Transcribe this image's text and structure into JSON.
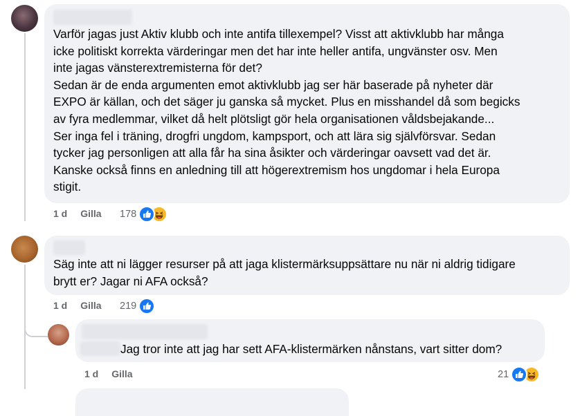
{
  "comments": [
    {
      "text": "Varför jagas just Aktiv klubb och inte antifa tillexempel? Visst att aktivklubb har många\nicke politiskt korrekta värderingar men det har inte heller antifa, ungvänster osv. Men\ninte jagas vänsterextremisterna för det?\nSedan är de enda argumenten emot aktivklubb jag ser här baserade på nyheter där\nEXPO är källan, och det säger ju ganska så mycket. Plus en misshandel då som begicks\nav fyra medlemmar, vilket då helt plötsligt gör hela organisationen våldsbejakande...\nSer inga fel i träning, drogfri ungdom, kampsport, och att lära sig självförsvar. Sedan\ntycker jag personligen att alla får ha sina åsikter och värderingar oavsett vad det är.\nKanske också finns en anledning till att högerextremism hos ungdomar i hela Europa\nstigit.",
      "time": "1 d",
      "like_label": "Gilla",
      "reaction_count": "178"
    },
    {
      "text": "Säg inte att ni lägger resurser på att jaga klistermärksuppsättare nu när ni aldrig tidigare\nbrytt er? Jagar ni AFA också?",
      "time": "1 d",
      "like_label": "Gilla",
      "reaction_count": "219"
    },
    {
      "text": "Jag tror inte att jag har sett AFA-klistermärken nånstans, vart sitter dom?",
      "time": "1 d",
      "like_label": "Gilla",
      "reaction_count": "21"
    }
  ],
  "colors": {
    "bubble": "#f0f2f5",
    "like": "#1877f2",
    "haha": "#f7b928",
    "secondary_text": "#65676b"
  },
  "icons": {
    "like": "like-reaction-icon",
    "haha": "haha-reaction-icon"
  }
}
